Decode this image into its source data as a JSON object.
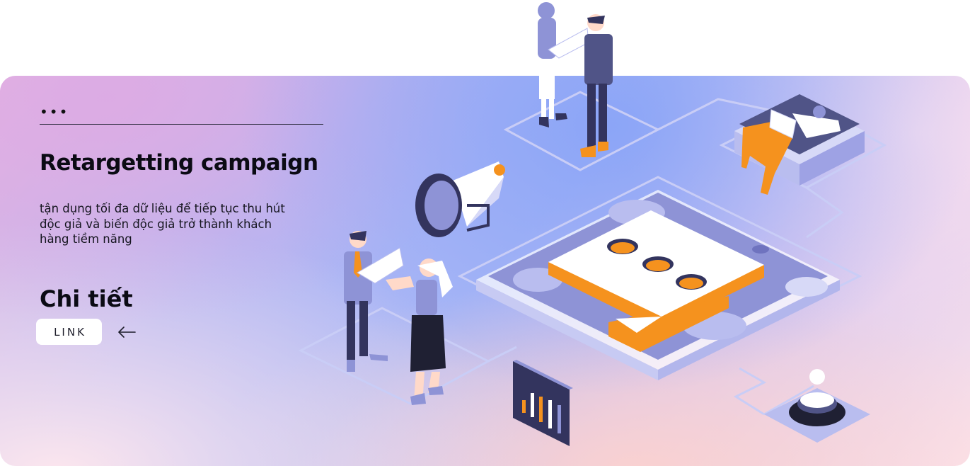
{
  "menu": {
    "dots": "•••"
  },
  "heading": {
    "title": "Retargetting campaign"
  },
  "description": "tận dụng tối đa dữ liệu để tiếp tục thu hút độc giả và biến độc giả trở thành khách hàng tiềm năng",
  "detail": {
    "heading": "Chi tiết",
    "link_label": "LINK",
    "arrow_icon": "arrow-left-icon"
  },
  "colors": {
    "accent_orange": "#f5921e",
    "navy": "#33345e",
    "lavender": "#8e93d6",
    "card_white": "#ffffff"
  }
}
